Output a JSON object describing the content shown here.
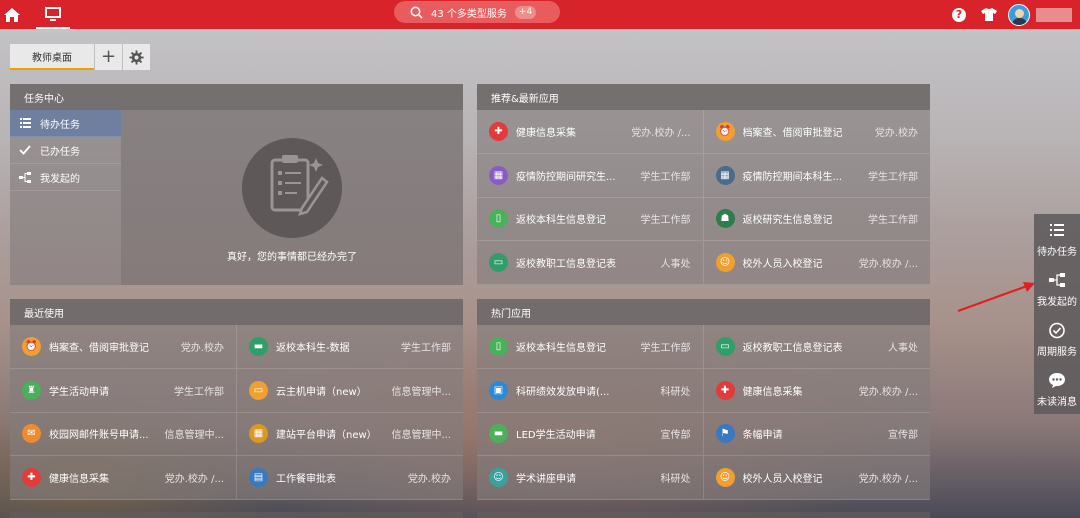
{
  "topbar": {
    "search_text": "43 个多类型服务",
    "badge": "+4",
    "help_label": "?"
  },
  "tabs": {
    "active_label": "教师桌面",
    "add_label": "+"
  },
  "task_center": {
    "title": "任务中心",
    "items": [
      {
        "label": "待办任务"
      },
      {
        "label": "已办任务"
      },
      {
        "label": "我发起的"
      }
    ],
    "empty_message": "真好，您的事情都已经办完了"
  },
  "recommend": {
    "title": "推荐&最新应用",
    "apps": [
      {
        "name": "健康信息采集",
        "dept": "党办.校办 /...",
        "icon": "red-cross-icon",
        "color": "#e23b3b",
        "glyph": "✚"
      },
      {
        "name": "档案查、借阅审批登记",
        "dept": "党办.校办",
        "icon": "alarm-clock-icon",
        "color": "#f0a030",
        "glyph": "⏰"
      },
      {
        "name": "疫情防控期间研究生...",
        "dept": "学生工作部",
        "icon": "building-icon",
        "color": "#8a5cc2",
        "glyph": "▦"
      },
      {
        "name": "疫情防控期间本科生...",
        "dept": "学生工作部",
        "icon": "building-icon",
        "color": "#4c6a8a",
        "glyph": "▦"
      },
      {
        "name": "返校本科生信息登记",
        "dept": "学生工作部",
        "icon": "phone-icon",
        "color": "#4bb05a",
        "glyph": "▯"
      },
      {
        "name": "返校研究生信息登记",
        "dept": "学生工作部",
        "icon": "graduate-icon",
        "color": "#2e7d4a",
        "glyph": "☗"
      },
      {
        "name": "返校教职工信息登记表",
        "dept": "人事处",
        "icon": "id-card-icon",
        "color": "#2f9e6a",
        "glyph": "▭"
      },
      {
        "name": "校外人员入校登记",
        "dept": "党办.校办 /...",
        "icon": "person-icon",
        "color": "#f0a030",
        "glyph": "☺"
      }
    ]
  },
  "recent": {
    "title": "最近使用",
    "apps": [
      {
        "name": "档案查、借阅审批登记",
        "dept": "党办.校办",
        "icon": "alarm-clock-icon",
        "color": "#f0a030",
        "glyph": "⏰"
      },
      {
        "name": "返校本科生-数据",
        "dept": "学生工作部",
        "icon": "bus-icon",
        "color": "#2e9e6a",
        "glyph": "▬"
      },
      {
        "name": "学生活动申请",
        "dept": "学生工作部",
        "icon": "stadium-icon",
        "color": "#4bb05a",
        "glyph": "♜"
      },
      {
        "name": "云主机申请（new）",
        "dept": "信息管理中...",
        "icon": "monitor-icon",
        "color": "#f0a030",
        "glyph": "▭"
      },
      {
        "name": "校园网邮件账号申请...",
        "dept": "信息管理中...",
        "icon": "mail-icon",
        "color": "#f08a30",
        "glyph": "✉"
      },
      {
        "name": "建站平台申请（new）",
        "dept": "信息管理中...",
        "icon": "calculator-icon",
        "color": "#d89a20",
        "glyph": "▦"
      },
      {
        "name": "健康信息采集",
        "dept": "党办.校办 /...",
        "icon": "red-cross-icon",
        "color": "#e23b3b",
        "glyph": "✚"
      },
      {
        "name": "工作餐审批表",
        "dept": "党办.校办",
        "icon": "document-icon",
        "color": "#3a78c2",
        "glyph": "▤"
      }
    ]
  },
  "hot": {
    "title": "热门应用",
    "apps": [
      {
        "name": "返校本科生信息登记",
        "dept": "学生工作部",
        "icon": "phone-icon",
        "color": "#4bb05a",
        "glyph": "▯"
      },
      {
        "name": "返校教职工信息登记表",
        "dept": "人事处",
        "icon": "id-card-icon",
        "color": "#2f9e6a",
        "glyph": "▭"
      },
      {
        "name": "科研绩效发放申请(...",
        "dept": "科研处",
        "icon": "box-icon",
        "color": "#2a8ad8",
        "glyph": "▣"
      },
      {
        "name": "健康信息采集",
        "dept": "党办.校办 /...",
        "icon": "red-cross-icon",
        "color": "#e23b3b",
        "glyph": "✚"
      },
      {
        "name": "LED学生活动申请",
        "dept": "宣传部",
        "icon": "led-screen-icon",
        "color": "#4bb05a",
        "glyph": "▬"
      },
      {
        "name": "条幅申请",
        "dept": "宣传部",
        "icon": "banner-icon",
        "color": "#3a78c2",
        "glyph": "⚑"
      },
      {
        "name": "学术讲座申请",
        "dept": "科研处",
        "icon": "lecturer-icon",
        "color": "#3aa0a0",
        "glyph": "☺"
      },
      {
        "name": "校外人员入校登记",
        "dept": "党办.校办 /...",
        "icon": "person-icon",
        "color": "#f0a030",
        "glyph": "☺"
      }
    ]
  },
  "float_bar": {
    "items": [
      {
        "label": "待办任务"
      },
      {
        "label": "我发起的"
      },
      {
        "label": "周期服务"
      },
      {
        "label": "未读消息"
      }
    ]
  }
}
